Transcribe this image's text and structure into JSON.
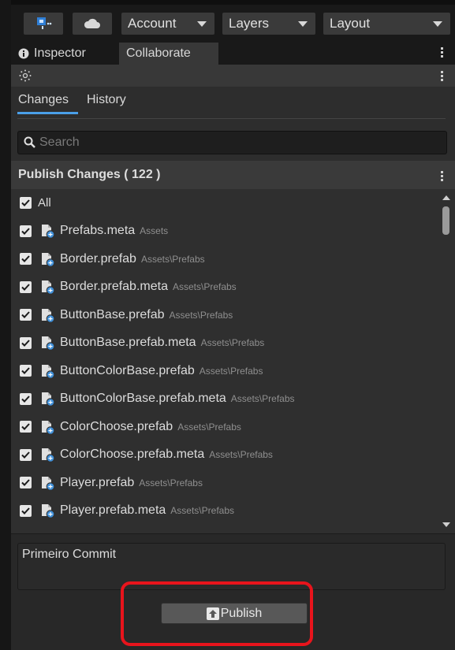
{
  "toolbar": {
    "collab_icon": "collaborate-icon",
    "cloud_icon": "cloud-icon",
    "account_label": "Account",
    "layers_label": "Layers",
    "layout_label": "Layout"
  },
  "tabs": [
    {
      "icon": "info-icon",
      "label": "Inspector"
    },
    {
      "label": "Collaborate"
    }
  ],
  "subtabs": {
    "changes": "Changes",
    "history": "History"
  },
  "search": {
    "placeholder": "Search"
  },
  "publish_changes": {
    "title": "Publish Changes ( 122 )"
  },
  "all_label": "All",
  "files": [
    {
      "name": "Prefabs.meta",
      "path": "Assets"
    },
    {
      "name": "Border.prefab",
      "path": "Assets\\Prefabs"
    },
    {
      "name": "Border.prefab.meta",
      "path": "Assets\\Prefabs"
    },
    {
      "name": "ButtonBase.prefab",
      "path": "Assets\\Prefabs"
    },
    {
      "name": "ButtonBase.prefab.meta",
      "path": "Assets\\Prefabs"
    },
    {
      "name": "ButtonColorBase.prefab",
      "path": "Assets\\Prefabs"
    },
    {
      "name": "ButtonColorBase.prefab.meta",
      "path": "Assets\\Prefabs"
    },
    {
      "name": "ColorChoose.prefab",
      "path": "Assets\\Prefabs"
    },
    {
      "name": "ColorChoose.prefab.meta",
      "path": "Assets\\Prefabs"
    },
    {
      "name": "Player.prefab",
      "path": "Assets\\Prefabs"
    },
    {
      "name": "Player.prefab.meta",
      "path": "Assets\\Prefabs"
    }
  ],
  "commit_message": "Primeiro Commit",
  "publish_label": "Publish",
  "colors": {
    "highlight": "#e8141c",
    "accent": "#4a9fe8",
    "file_icon_badge": "#3f8fd8"
  }
}
